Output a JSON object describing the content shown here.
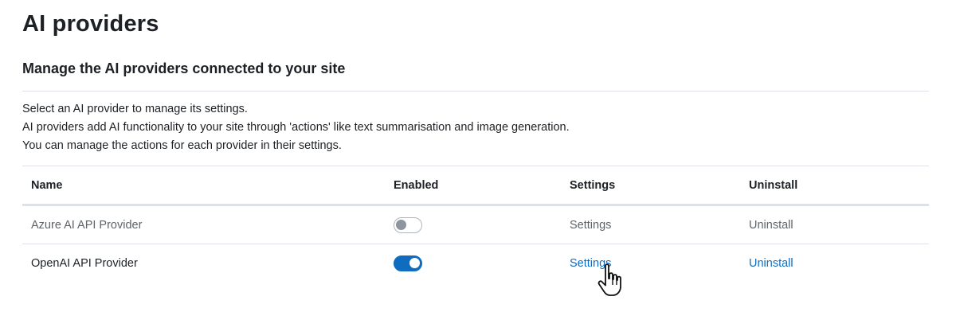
{
  "page": {
    "title": "AI providers",
    "subheading": "Manage the AI providers connected to your site",
    "description": [
      "Select an AI provider to manage its settings.",
      "AI providers add AI functionality to your site through 'actions' like text summarisation and image generation.",
      "You can manage the actions for each provider in their settings."
    ]
  },
  "table": {
    "columns": [
      "Name",
      "Enabled",
      "Settings",
      "Uninstall"
    ],
    "rows": [
      {
        "name": "Azure AI API Provider",
        "enabled": false,
        "settings": "Settings",
        "uninstall": "Uninstall"
      },
      {
        "name": "OpenAI API Provider",
        "enabled": true,
        "settings": "Settings",
        "uninstall": "Uninstall"
      }
    ]
  },
  "colors": {
    "accent": "#0f6cbf",
    "muted": "#5f6368",
    "border": "#dee2e6"
  },
  "icons": {
    "cursor": "hand-pointer-icon"
  }
}
